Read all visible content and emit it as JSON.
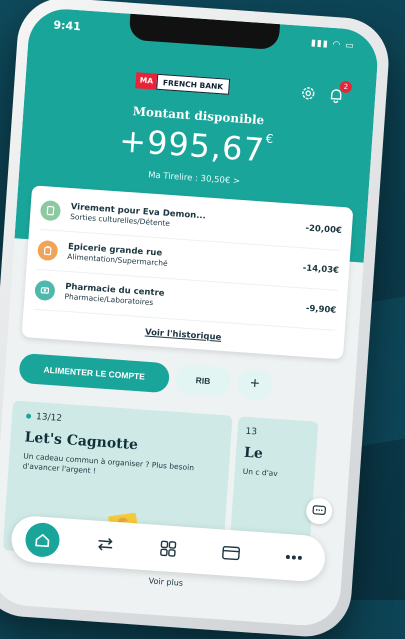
{
  "status_bar": {
    "time": "9:41"
  },
  "brand": {
    "ma": "MA",
    "french_bank": "FRENCH BANK"
  },
  "header": {
    "notification_count": "2"
  },
  "balance": {
    "label": "Montant disponible",
    "amount": "+995,67",
    "currency": "€",
    "tirelire": "Ma Tirelire : 30,50€ >"
  },
  "transactions": [
    {
      "title": "Virement pour Eva Demon...",
      "subtitle": "Sorties culturelles/Détente",
      "amount": "-20,00€",
      "icon": "transfer-icon",
      "color": "#8cc9a0"
    },
    {
      "title": "Épicerie grande rue",
      "subtitle": "Alimentation/Supermarché",
      "amount": "-14,03€",
      "icon": "grocery-icon",
      "color": "#f0a45a"
    },
    {
      "title": "Pharmacie du centre",
      "subtitle": "Pharmacie/Laboratoires",
      "amount": "-9,90€",
      "icon": "pharmacy-icon",
      "color": "#4fb8ad"
    }
  ],
  "history_link": "Voir l'historique",
  "actions": {
    "primary": "ALIMENTER LE COMPTE",
    "rib": "RIB",
    "plus": "+"
  },
  "promo": {
    "date": "13/12",
    "title": "Let's Cagnotte",
    "text": "Un cadeau commun à organiser ? Plus besoin d'avancer l'argent !"
  },
  "promo2": {
    "date": "13",
    "title": "Le",
    "text": "Un c d'av"
  },
  "see_more": "Voir plus",
  "colors": {
    "teal": "#1aa59b",
    "red": "#e8243a",
    "navy": "#0b3a4a"
  }
}
